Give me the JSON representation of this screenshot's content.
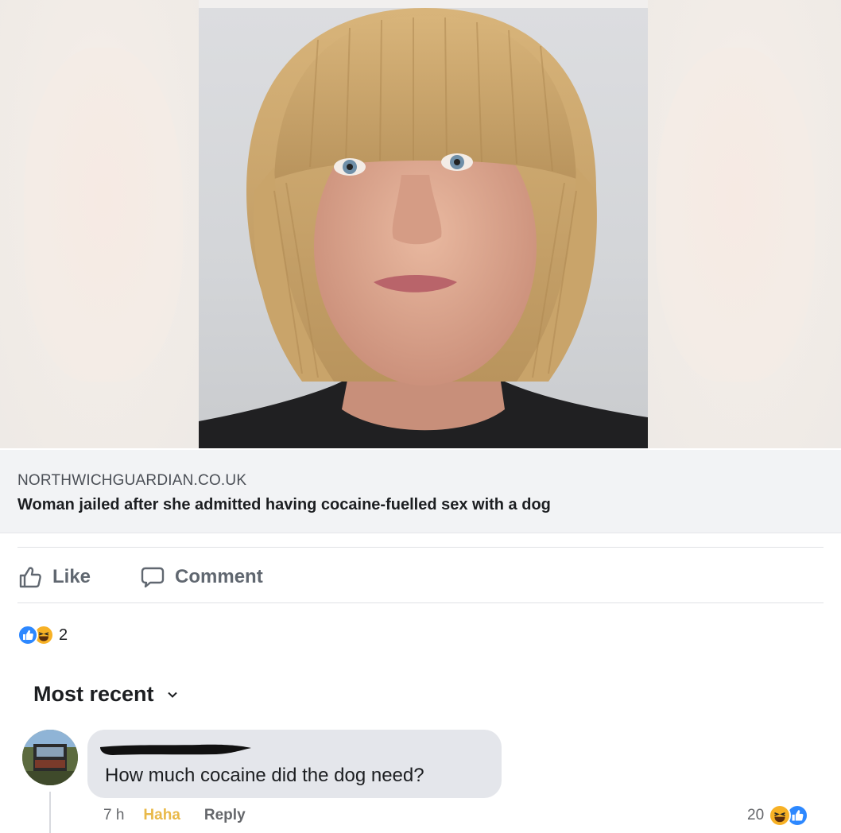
{
  "link_preview": {
    "domain": "NORTHWICHGUARDIAN.CO.UK",
    "title": "Woman jailed after she admitted having cocaine-fuelled sex with a dog"
  },
  "actions": {
    "like_label": "Like",
    "comment_label": "Comment"
  },
  "reactions_summary": {
    "count": "2",
    "types": [
      "like-icon",
      "haha-icon"
    ]
  },
  "comments_sort": {
    "label": "Most recent"
  },
  "comment": {
    "text": "How much cocaine did the dog need?",
    "time": "7 h",
    "haha_label": "Haha",
    "reply_label": "Reply",
    "reaction_count": "20",
    "reaction_types": [
      "haha-icon",
      "like-icon"
    ]
  },
  "colors": {
    "like_blue": "#2d88ff",
    "haha_yellow": "#f7b125",
    "bubble_gray": "#e4e6eb",
    "meta_gray": "#65676b"
  }
}
